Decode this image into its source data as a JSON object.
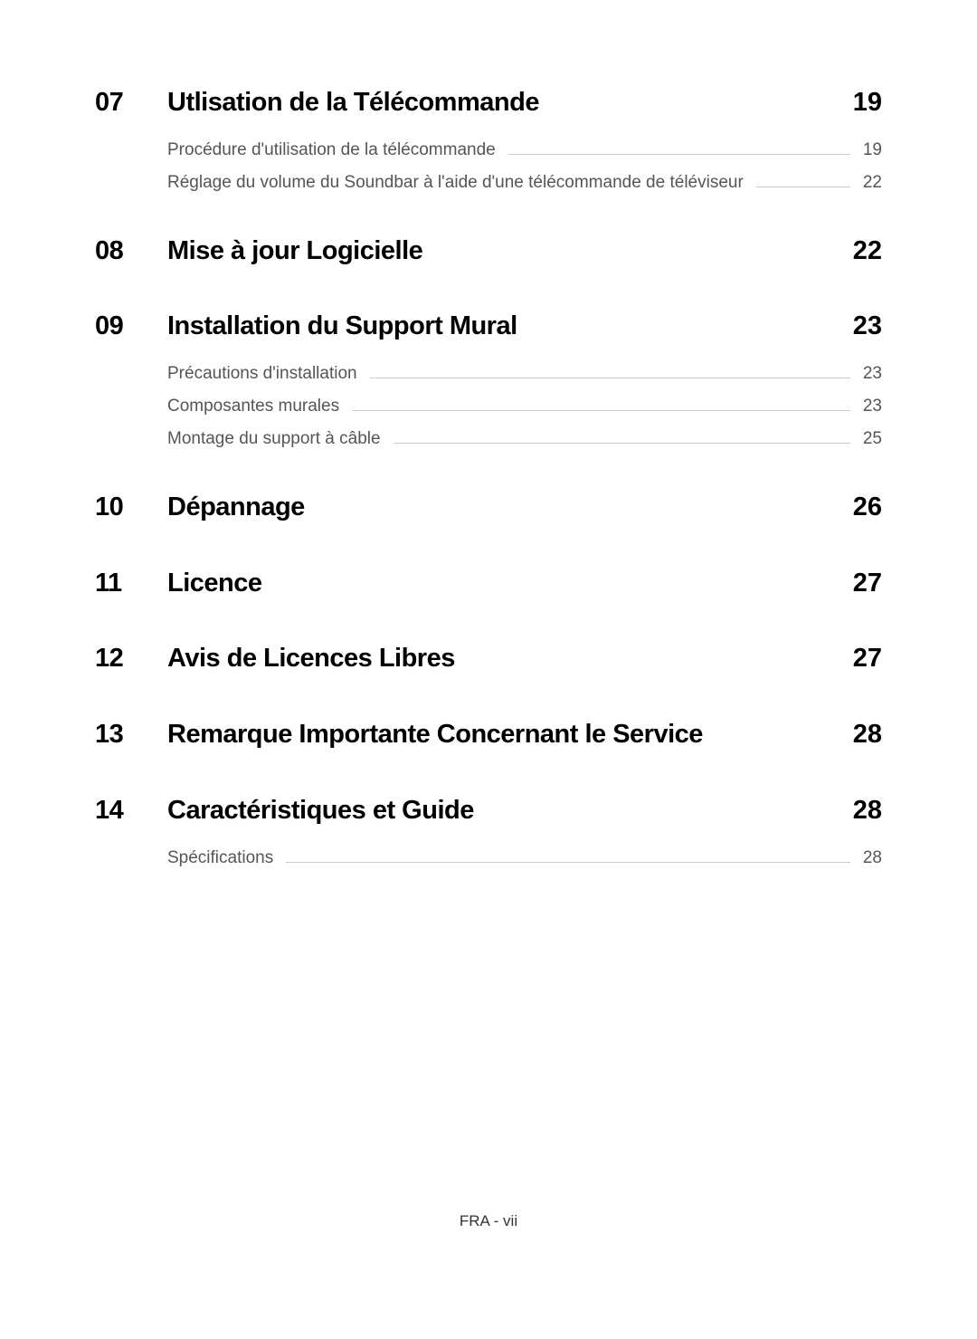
{
  "footer": "FRA - vii",
  "sections": [
    {
      "num": "07",
      "title": "Utlisation de la Télécommande",
      "page": "19",
      "subs": [
        {
          "title": "Procédure d'utilisation de la télécommande",
          "page": "19"
        },
        {
          "title": "Réglage du volume du Soundbar à l'aide d'une télécommande de téléviseur",
          "page": "22"
        }
      ]
    },
    {
      "num": "08",
      "title": "Mise à jour Logicielle",
      "page": "22",
      "subs": []
    },
    {
      "num": "09",
      "title": "Installation du Support Mural",
      "page": "23",
      "subs": [
        {
          "title": "Précautions d'installation",
          "page": "23"
        },
        {
          "title": "Composantes murales",
          "page": "23"
        },
        {
          "title": "Montage du support à câble",
          "page": "25"
        }
      ]
    },
    {
      "num": "10",
      "title": "Dépannage",
      "page": "26",
      "subs": []
    },
    {
      "num": "11",
      "title": "Licence",
      "page": "27",
      "subs": []
    },
    {
      "num": "12",
      "title": "Avis de Licences Libres",
      "page": "27",
      "subs": []
    },
    {
      "num": "13",
      "title": "Remarque Importante Concernant le Service",
      "page": "28",
      "subs": []
    },
    {
      "num": "14",
      "title": "Caractéristiques et Guide",
      "page": "28",
      "subs": [
        {
          "title": "Spécifications",
          "page": "28"
        }
      ]
    }
  ]
}
